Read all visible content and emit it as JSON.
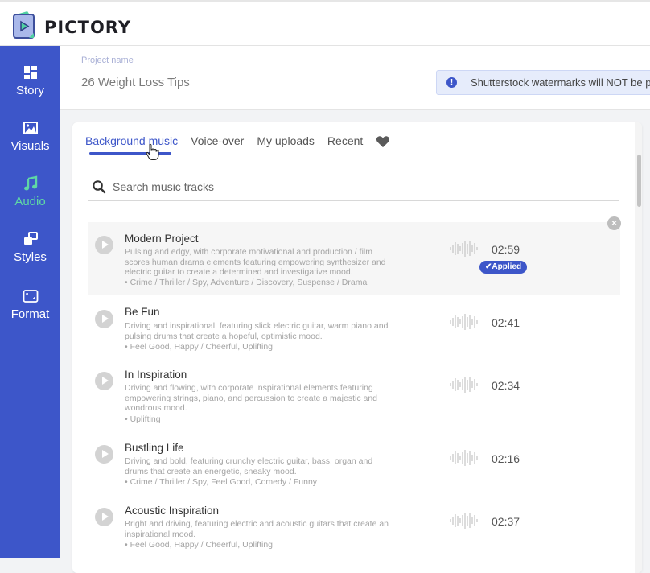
{
  "app": {
    "brand": "PICTORY"
  },
  "sidebar": {
    "items": [
      {
        "label": "Story",
        "icon": "grid-icon",
        "active": false
      },
      {
        "label": "Visuals",
        "icon": "image-icon",
        "active": false
      },
      {
        "label": "Audio",
        "icon": "music-note-icon",
        "active": true
      },
      {
        "label": "Styles",
        "icon": "layers-icon",
        "active": false
      },
      {
        "label": "Format",
        "icon": "aspect-ratio-icon",
        "active": false
      }
    ]
  },
  "project": {
    "label": "Project name",
    "name": "26 Weight Loss Tips"
  },
  "notice": {
    "text": "Shutterstock watermarks will NOT be pr"
  },
  "audio_panel": {
    "tabs": [
      {
        "label": "Background music",
        "active": true
      },
      {
        "label": "Voice-over",
        "active": false
      },
      {
        "label": "My uploads",
        "active": false
      },
      {
        "label": "Recent",
        "active": false
      }
    ],
    "favorites_icon": "heart-icon",
    "search": {
      "placeholder": "Search music tracks",
      "value": ""
    },
    "applied_label": "Applied",
    "tracks": [
      {
        "title": "Modern Project",
        "description": "Pulsing and edgy, with corporate motivational and production / film scores human drama elements featuring empowering synthesizer and electric guitar to create a determined and investigative mood.",
        "tags": "• Crime / Thriller / Spy, Adventure / Discovery, Suspense / Drama",
        "duration": "02:59",
        "applied": true
      },
      {
        "title": "Be Fun",
        "description": "Driving and inspirational, featuring slick electric guitar, warm piano and pulsing drums that create a hopeful, optimistic mood.",
        "tags": "• Feel Good, Happy / Cheerful, Uplifting",
        "duration": "02:41",
        "applied": false
      },
      {
        "title": "In Inspiration",
        "description": "Driving and flowing, with corporate inspirational elements featuring empowering strings, piano, and percussion to create a majestic and wondrous mood.",
        "tags": "• Uplifting",
        "duration": "02:34",
        "applied": false
      },
      {
        "title": "Bustling Life",
        "description": "Driving and bold, featuring crunchy electric guitar, bass, organ and drums that create an energetic, sneaky mood.",
        "tags": "• Crime / Thriller / Spy, Feel Good, Comedy / Funny",
        "duration": "02:16",
        "applied": false
      },
      {
        "title": "Acoustic Inspiration",
        "description": "Bright and driving, featuring electric and acoustic guitars that create an inspirational mood.",
        "tags": "• Feel Good, Happy / Cheerful, Uplifting",
        "duration": "02:37",
        "applied": false
      }
    ]
  }
}
